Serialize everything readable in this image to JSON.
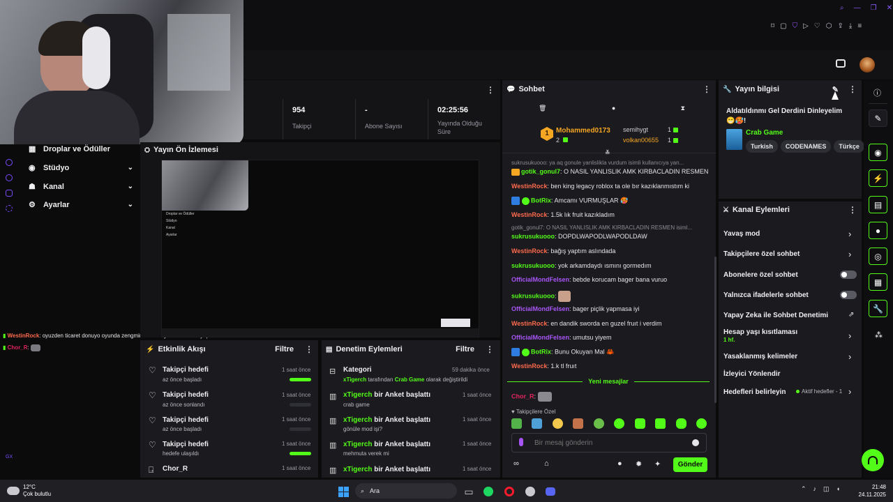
{
  "stats": [
    {
      "value": "954",
      "label": "Takipçi"
    },
    {
      "value": "-",
      "label": "Abone Sayısı"
    },
    {
      "value": "02:25:56",
      "label": "Yayında Olduğu Süre"
    }
  ],
  "sidebar": {
    "items": [
      {
        "label": "Droplar ve Ödüller"
      },
      {
        "label": "Stüdyo"
      },
      {
        "label": "Kanal"
      },
      {
        "label": "Ayarlar"
      }
    ]
  },
  "preview": {
    "title": "Yayın Ön İzlemesi",
    "mini_menu": [
      "Droplar ve Ödüller",
      "Stüdyo",
      "Kanal",
      "Ayarlar"
    ]
  },
  "overlay_chat": [
    {
      "user": "WestinRock",
      "text": ": oyuzden ticaret donuyo oyunda zengmim zaten oyuzden ticaret yapcam"
    },
    {
      "user": "Chor_R",
      "text": ":"
    }
  ],
  "overlay_badge": "GX",
  "chat": {
    "title": "Sohbet",
    "leaderboard": {
      "first": {
        "rank": "1",
        "user": "Mohammed0173",
        "count": "2"
      },
      "others": [
        {
          "user": "semihygt",
          "count": "1"
        },
        {
          "user": "volkan00655",
          "count": "1"
        }
      ]
    },
    "messages": [
      {
        "type": "reply",
        "text": "sukrusukuooo: ya aq gonule yanlislikla vurdum isimli kullanıcıya yan..."
      },
      {
        "type": "msg",
        "user": "gotik_gonul7",
        "color": "green",
        "text": ": O NASIL YANLISLIK AMK KIRBACLADIN RESMEN"
      },
      {
        "type": "msg",
        "user": "WestinRock",
        "color": "orange",
        "text": ": ben king legacy roblox ta ole bır kazıklanmıstım ki"
      },
      {
        "type": "msg",
        "user": "BotRix",
        "color": "green",
        "text": ": Amcamı VURMUŞLAR 🥵"
      },
      {
        "type": "msg",
        "user": "WestinRock",
        "color": "orange",
        "text": ": 1.5k lık fruit kazıkladım"
      },
      {
        "type": "reply",
        "text": "gotik_gonul7: O NASIL YANLISLIK AMK KIRBACLADIN RESMEN isiml..."
      },
      {
        "type": "msg",
        "user": "sukrusukuooo",
        "color": "green",
        "text": ": DOPDLWAPODLWAPODLDAW"
      },
      {
        "type": "msg",
        "user": "WestinRock",
        "color": "orange",
        "text": ": bağış yaptım aslındada"
      },
      {
        "type": "msg",
        "user": "sukrusukuooo",
        "color": "green",
        "text": ": yok arkamdaydı ısmını gormedım"
      },
      {
        "type": "msg",
        "user": "OfficialMondFelsen",
        "color": "purple",
        "text": ": bebde korucam bager bana vuruo"
      },
      {
        "type": "msg",
        "user": "sukrusukuooo",
        "color": "green",
        "text": ":"
      },
      {
        "type": "msg",
        "user": "OfficialMondFelsen",
        "color": "purple",
        "text": ": bager piçlik yapmasa iyi"
      },
      {
        "type": "msg",
        "user": "WestinRock",
        "color": "orange",
        "text": ": en dandik sworda en guzel fruıt i verdim"
      },
      {
        "type": "msg",
        "user": "OfficialMondFelsen",
        "color": "purple",
        "text": ": umutsu yiyem"
      },
      {
        "type": "msg",
        "user": "BotRix",
        "color": "green",
        "text": ": Bunu Okuyan Mal 🦀"
      },
      {
        "type": "msg",
        "user": "WestinRock",
        "color": "orange",
        "text": ": 1.k tl fruıt"
      }
    ],
    "new_messages": "Yeni mesajlar",
    "after_new": {
      "user": "Chor_R",
      "text": ":"
    },
    "followers_only_label": "Takipçilere Özel",
    "input_placeholder": "Bir mesaj gönderin",
    "send_label": "Gönder"
  },
  "stream_info": {
    "title": "Yayın bilgisi",
    "stream_title": "Aldatıldınmı Gel Derdini Dinleyelim 😁🥵!",
    "category": "Crab Game",
    "tags": [
      "Turkish",
      "CODENAMES",
      "Türkçe"
    ]
  },
  "channel_actions": {
    "title": "Kanal Eylemleri",
    "items": [
      {
        "label": "Yavaş mod",
        "control": "chevron"
      },
      {
        "label": "Takipçilere özel sohbet",
        "control": "chevron"
      },
      {
        "label": "Abonelere özel sohbet",
        "control": "toggle"
      },
      {
        "label": "Yalnızca ifadelerle sohbet",
        "control": "toggle"
      },
      {
        "label": "Yapay Zeka ile Sohbet Denetimi",
        "control": "external"
      },
      {
        "label": "Hesap yaşı kısıtlaması",
        "sub": "1 hf.",
        "control": "chevron"
      },
      {
        "label": "Yasaklanmış kelimeler",
        "control": "chevron"
      },
      {
        "label": "İzleyici Yönlendir",
        "control": "none"
      },
      {
        "label": "Hedefleri belirleyin",
        "note": "Aktif hedefler - 1",
        "control": "chevron"
      }
    ]
  },
  "activity": {
    "title": "Etkinlik Akışı",
    "filter": "Filtre",
    "events": [
      {
        "title": "Takipçi hedefi",
        "sub": "az önce başladı",
        "time": "1 saat önce",
        "progress": 1.0
      },
      {
        "title": "Takipçi hedefi",
        "sub": "az önce sonlandı",
        "time": "1 saat önce",
        "progress": 0.0
      },
      {
        "title": "Takipçi hedefi",
        "sub": "az önce başladı",
        "time": "1 saat önce",
        "progress": 0.0
      },
      {
        "title": "Takipçi hedefi",
        "sub": "hedefe ulaşıldı",
        "time": "1 saat önce",
        "progress": 1.0
      },
      {
        "title": "Chor_R",
        "sub": "",
        "time": "1 saat önce",
        "progress": null
      }
    ]
  },
  "moderation": {
    "title": "Denetim Eylemleri",
    "filter": "Filtre",
    "events": [
      {
        "user": "",
        "action": "Kategori",
        "sub": "xTigerch tarafından Crab Game olarak değiştirildi",
        "time": "59 dakika önce"
      },
      {
        "user": "xTigerch",
        "action": " bir Anket başlattı",
        "sub": "crab game",
        "time": "1 saat önce"
      },
      {
        "user": "xTigerch",
        "action": " bir Anket başlattı",
        "sub": "gönüle mod işi?",
        "time": "1 saat önce"
      },
      {
        "user": "xTigerch",
        "action": " bir Anket başlattı",
        "sub": "mehmuta verek mi",
        "time": "1 saat önce"
      },
      {
        "user": "xTigerch",
        "action": " bir Anket başlattı",
        "sub": "",
        "time": "1 saat önce"
      }
    ]
  },
  "taskbar": {
    "weather_temp": "12°C",
    "weather_desc": "Çok bulutlu",
    "search": "Ara",
    "time": "21:48",
    "date": "24.11.2025"
  },
  "colors": {
    "accent": "#53fc18",
    "bg": "#0b0b0c",
    "panel": "#1b1b1f"
  }
}
